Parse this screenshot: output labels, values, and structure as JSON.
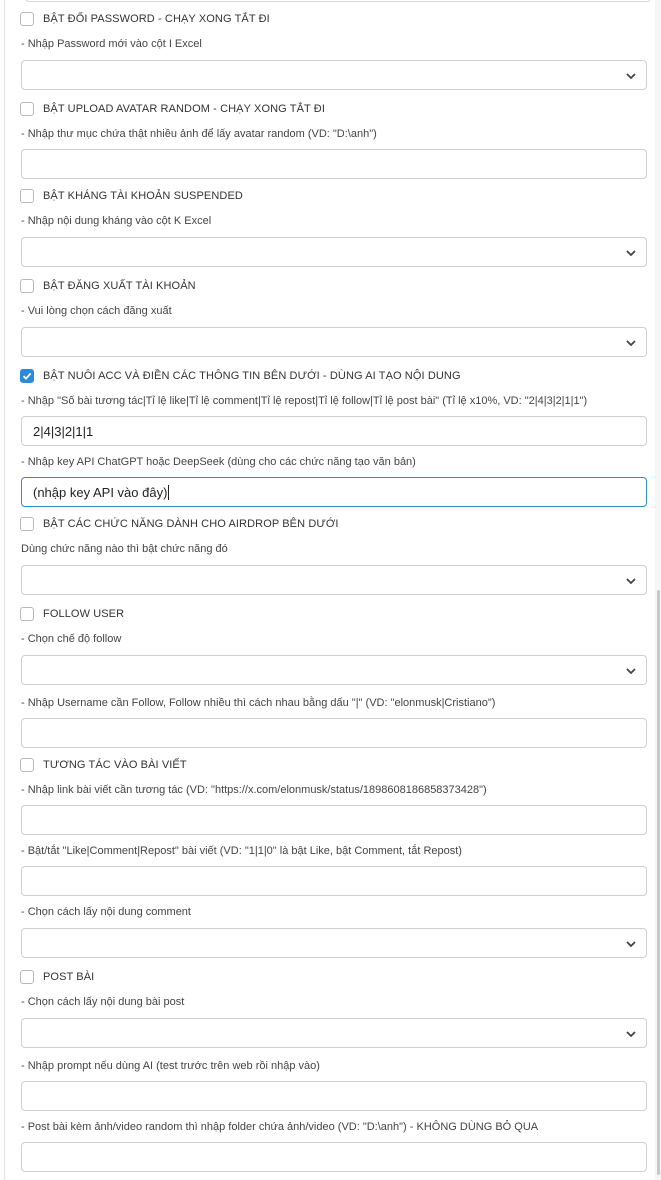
{
  "form": {
    "pw_toggle": "BẬT ĐỔI PASSWORD - CHẠY XONG TẮT ĐI",
    "pw_hint": "- Nhập Password mới vào cột I Excel",
    "avatar_toggle": "BẬT UPLOAD AVATAR RANDOM - CHẠY XONG TẮT ĐI",
    "avatar_hint": "- Nhập thư mục chứa thật nhiều ảnh để lấy avatar random (VD: \"D:\\anh\")",
    "suspend_toggle": "BẬT KHÁNG TÀI KHOẢN SUSPENDED",
    "suspend_hint": "- Nhập nội dung kháng vào cột K Excel",
    "logout_toggle": "BẬT ĐĂNG XUẤT TÀI KHOẢN",
    "logout_hint": "- Vui lòng chọn cách đăng xuất",
    "nurture_toggle": "BẬT NUÔI ACC VÀ ĐIỀN CÁC THÔNG TIN BÊN DƯỚI - DÙNG AI TẠO NỘI DUNG",
    "ratio_hint": "- Nhập \"Số bài tương tác|Tỉ lệ like|Tỉ lệ comment|Tỉ lệ repost|Tỉ lệ follow|Tỉ lệ post bài\" (Tỉ lệ x10%, VD: \"2|4|3|2|1|1\")",
    "ratio_value": "2|4|3|2|1|1",
    "apikey_hint": "- Nhập key API ChatGPT hoặc DeepSeek (dùng cho các chức năng tạo văn bản)",
    "apikey_value": "(nhập key API vào đây)",
    "airdrop_toggle": "BẬT CÁC CHỨC NĂNG DÀNH CHO AIRDROP BÊN DƯỚI",
    "airdrop_hint": "Dùng chức năng nào thì bật chức năng đó",
    "follow_toggle": "FOLLOW USER",
    "follow_mode_hint": "- Chọn chế độ follow",
    "follow_user_hint": "- Nhập Username cần Follow, Follow nhiều thì cách nhau bằng dấu \"|\" (VD: \"elonmusk|Cristiano\")",
    "interact_toggle": "TƯƠNG TÁC VÀO BÀI VIẾT",
    "link_hint": "- Nhập link bài viết cần tương tác (VD: \"https://x.com/elonmusk/status/1898608186858373428\")",
    "lcr_hint": "- Bật/tắt \"Like|Comment|Repost\" bài viết (VD: \"1|1|0\" là bật Like, bật Comment, tắt Repost)",
    "comment_hint": "- Chọn cách lấy nội dung comment",
    "post_toggle": "POST BÀI",
    "post_content_hint": "- Chọn cách lấy nội dung bài post",
    "prompt_hint": "- Nhập prompt nếu dùng AI (test trước trên web rồi nhập vào)",
    "media_hint": "- Post bài kèm ảnh/video random thì nhập folder chứa ảnh/video (VD: \"D:\\anh\") - KHÔNG DÙNG BỎ QUA"
  },
  "state": {
    "nurture_checked": true
  },
  "colors": {
    "checkbox_checked": "#2b8bd8",
    "focus_border": "#2f90c9"
  }
}
